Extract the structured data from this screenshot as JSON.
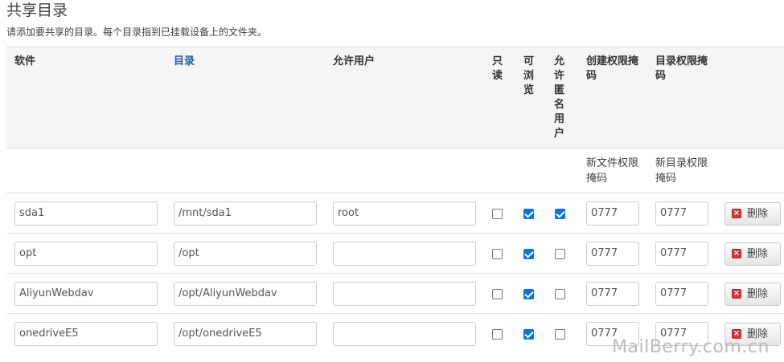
{
  "page": {
    "title": "共享目录",
    "description": "请添加要共享的目录。每个目录指到已挂载设备上的文件夹。"
  },
  "table": {
    "headers": {
      "software": "软件",
      "directory": "目录",
      "allowed_users": "允许用户",
      "readonly": "只读",
      "browsable": "可浏览",
      "guest": "允许匿名用户",
      "create_mask": "创建权限掩码",
      "dir_mask": "目录权限掩码"
    },
    "subheaders": {
      "create_mask": "新文件权限掩码",
      "dir_mask": "新目录权限掩码"
    },
    "delete_label": "删除",
    "rows": [
      {
        "name": "sda1",
        "path": "/mnt/sda1",
        "users": "root",
        "readonly": false,
        "browsable": true,
        "guest": true,
        "create_mask": "0777",
        "dir_mask": "0777"
      },
      {
        "name": "opt",
        "path": "/opt",
        "users": "",
        "readonly": false,
        "browsable": true,
        "guest": false,
        "create_mask": "0777",
        "dir_mask": "0777"
      },
      {
        "name": "AliyunWebdav",
        "path": "/opt/AliyunWebdav",
        "users": "",
        "readonly": false,
        "browsable": true,
        "guest": false,
        "create_mask": "0777",
        "dir_mask": "0777"
      },
      {
        "name": "onedriveE5",
        "path": "/opt/onedriveE5",
        "users": "",
        "readonly": false,
        "browsable": true,
        "guest": false,
        "create_mask": "0777",
        "dir_mask": "0777"
      }
    ]
  },
  "watermark": "MailBerry.com.cn",
  "icons": {
    "delete": "delete-x-icon"
  },
  "colors": {
    "checkbox_on": "#0b73d9",
    "link": "#1d5ea8",
    "delete_icon": "#d9343b"
  }
}
